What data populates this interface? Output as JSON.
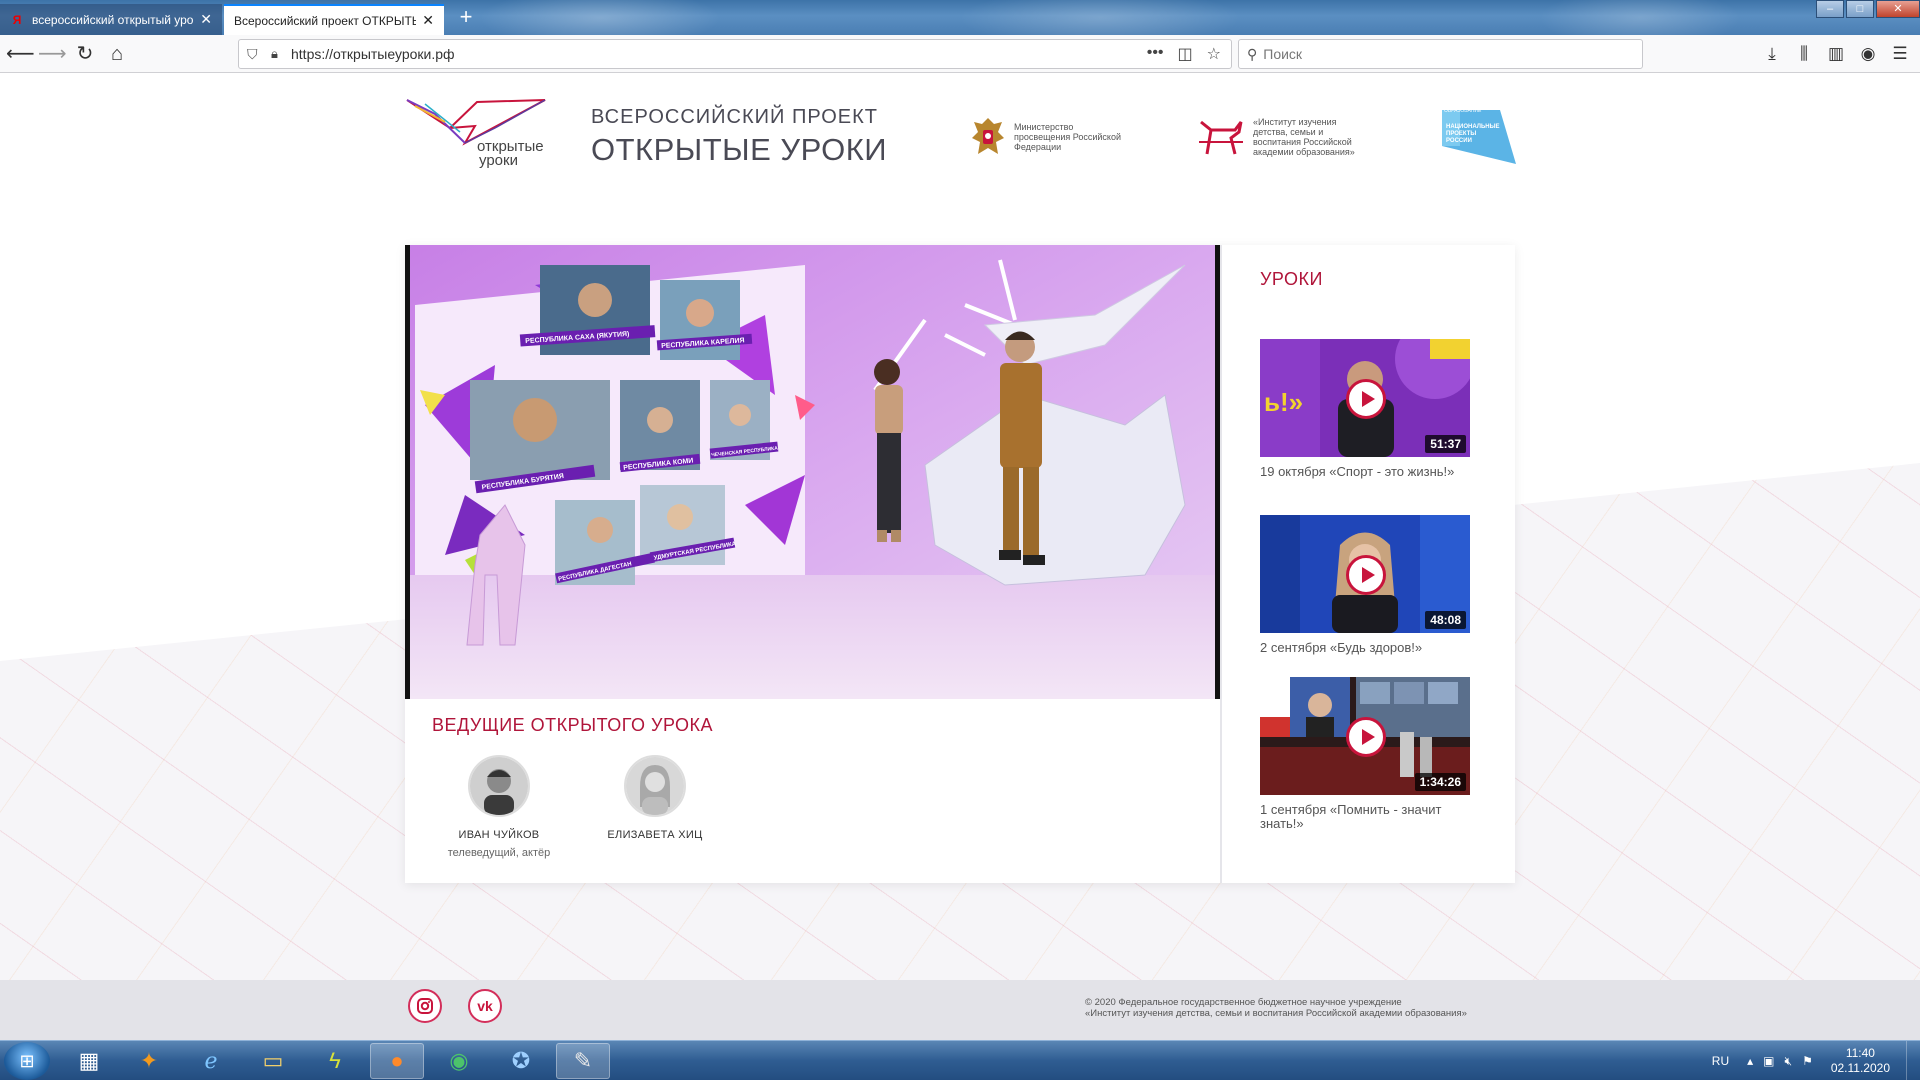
{
  "browser": {
    "tabs": [
      {
        "title": "всероссийский открытый урок",
        "favicon": "Я",
        "active": false
      },
      {
        "title": "Всероссийский проект ОТКРЫТЫЕ",
        "favicon": "",
        "active": true
      }
    ],
    "url": "https://открытыеуроки.рф",
    "search_placeholder": "Поиск",
    "url_more": "•••"
  },
  "header": {
    "logo_text_line1": "открытые",
    "logo_text_line2": "уроки",
    "project_subtitle": "ВСЕРОССИЙСКИЙ ПРОЕКТ",
    "project_title": "ОТКРЫТЫЕ УРОКИ",
    "ministry_text": "Министерство просвещения Российской Федерации",
    "institute_text": "«Институт изучения детства, семьи и воспитания Российской академии образования»",
    "natproj_text": "НАЦИОНАЛЬНЫЕ ПРОЕКТЫ РОССИИ",
    "natproj_small": "ОБРАЗОВАНИЕ"
  },
  "video": {
    "screen_labels": [
      "РЕСПУБЛИКА САХА (ЯКУТИЯ)",
      "РЕСПУБЛИКА КАРЕЛИЯ",
      "РЕСПУБЛИКА БУРЯТИЯ",
      "РЕСПУБЛИКА КОМИ",
      "ЧЕЧЕНСКАЯ РЕСПУБЛИКА",
      "РЕСПУБЛИКА ДАГЕСТАН",
      "УДМУРТСКАЯ РЕСПУБЛИКА"
    ]
  },
  "hosts": {
    "title": "ВЕДУЩИЕ ОТКРЫТОГО УРОКА",
    "items": [
      {
        "name": "ИВАН ЧУЙКОВ",
        "role": "телеведущий, актёр"
      },
      {
        "name": "ЕЛИЗАВЕТА ХИЦ",
        "role": ""
      }
    ]
  },
  "lessons": {
    "title": "УРОКИ",
    "items": [
      {
        "caption": "19 октября «Спорт - это жизнь!»",
        "duration": "51:37",
        "badge": "ь!»"
      },
      {
        "caption": "2 сентября «Будь здоров!»",
        "duration": "48:08"
      },
      {
        "caption": "1 сентября «Помнить - значит знать!»",
        "duration": "1:34:26"
      }
    ]
  },
  "footer": {
    "instagram_icon": "instagram-icon",
    "vk_label": "vk",
    "copyright_line1": "© 2020 Федеральное государственное бюджетное научное учреждение",
    "copyright_line2": "«Институт изучения детства, семьи и воспитания Российской академии образования»"
  },
  "taskbar": {
    "lang": "RU",
    "time": "11:40",
    "date": "02.11.2020"
  },
  "colors": {
    "accent": "#b0153a",
    "play": "#c8143c",
    "taskbar": "#2f5d92"
  }
}
